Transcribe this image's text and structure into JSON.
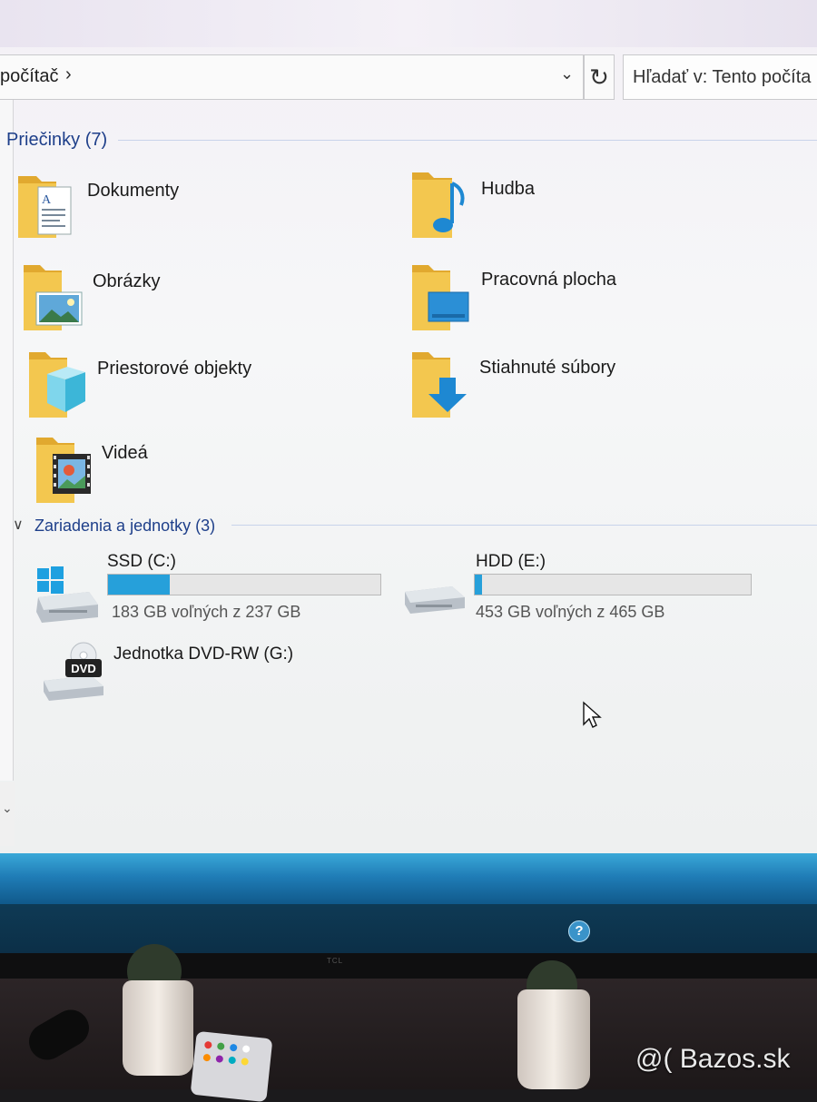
{
  "address_bar": {
    "path": "počítač",
    "separator": "›",
    "dropdown_glyph": "⌄",
    "refresh_glyph": "↻"
  },
  "search": {
    "text": "Hľadať v: Tento počíta"
  },
  "folders_group": {
    "header": "Priečinky (7)",
    "items": [
      {
        "label": "Dokumenty",
        "icon": "documents-folder-icon"
      },
      {
        "label": "Hudba",
        "icon": "music-folder-icon"
      },
      {
        "label": "Obrázky",
        "icon": "pictures-folder-icon"
      },
      {
        "label": "Pracovná plocha",
        "icon": "desktop-folder-icon"
      },
      {
        "label": "Priestorové objekty",
        "icon": "3d-objects-folder-icon"
      },
      {
        "label": "Stiahnuté súbory",
        "icon": "downloads-folder-icon"
      },
      {
        "label": "Videá",
        "icon": "videos-folder-icon"
      }
    ]
  },
  "devices_group": {
    "chevron": "∨",
    "header": "Zariadenia a jednotky (3)",
    "drives": [
      {
        "name": "SSD (C:)",
        "free_text": "183 GB voľných z 237 GB",
        "used_fraction": 0.228,
        "icon": "windows-drive-icon"
      },
      {
        "name": "HDD (E:)",
        "free_text": "453 GB voľných z 465 GB",
        "used_fraction": 0.026,
        "icon": "hard-drive-icon"
      },
      {
        "name": "Jednotka DVD-RW (G:)",
        "icon": "dvd-drive-icon",
        "badge": "DVD"
      }
    ]
  },
  "taskbar": {
    "help_glyph": "?"
  },
  "monitor": {
    "brand": "TCL"
  },
  "watermark": "@( Bazos.sk",
  "colors": {
    "folder_yellow": "#f0c24a",
    "accent_blue": "#26a0da",
    "group_header": "#1e3f8a",
    "taskbar_blue": "#1f7cb6"
  }
}
